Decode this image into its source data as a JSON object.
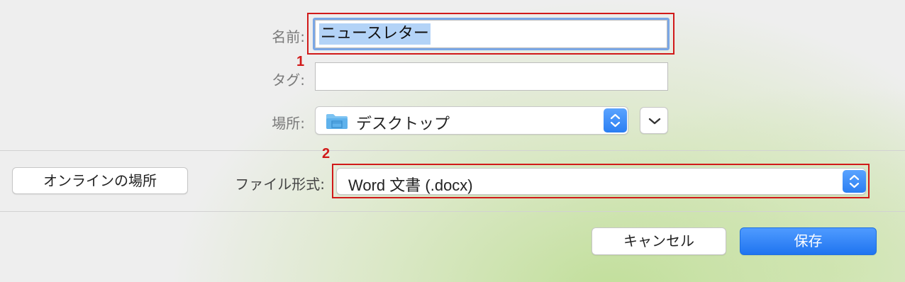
{
  "dialog": {
    "name_label": "名前:",
    "name_value": "ニュースレター",
    "tags_label": "タグ:",
    "tags_value": "",
    "location_label": "場所:",
    "location_value": "デスクトップ",
    "online_button": "オンラインの場所",
    "format_label": "ファイル形式:",
    "format_value": "Word 文書 (.docx)",
    "cancel_button": "キャンセル",
    "save_button": "保存"
  },
  "annotations": {
    "marker_1": "1",
    "marker_2": "2"
  },
  "colors": {
    "highlight_red": "#d11a1a",
    "accent_blue": "#2a7ef2",
    "selection": "#b3d3f7"
  },
  "icons": {
    "location": "folder-icon",
    "location_stepper": "chevron-updown-icon",
    "expand": "chevron-down-icon",
    "format_stepper": "chevron-updown-icon"
  }
}
